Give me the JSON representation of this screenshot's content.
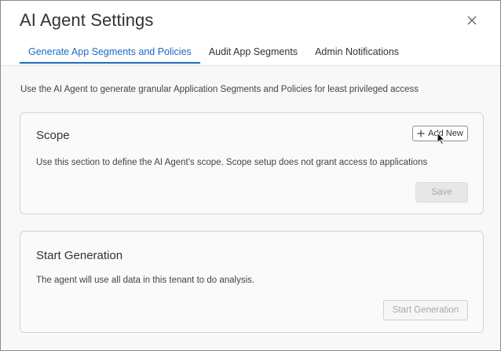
{
  "dialog": {
    "title": "AI Agent Settings",
    "close_icon": "close-icon"
  },
  "tabs": [
    {
      "label": "Generate App Segments and Policies",
      "active": true
    },
    {
      "label": "Audit App Segments",
      "active": false
    },
    {
      "label": "Admin Notifications",
      "active": false
    }
  ],
  "intro": "Use the AI Agent to generate granular Application Segments and Policies for least privileged access",
  "scope": {
    "title": "Scope",
    "add_new_label": "Add New",
    "add_icon": "plus-icon",
    "description": "Use this section to define the AI Agent's scope. Scope setup does not grant access to applications",
    "save_label": "Save"
  },
  "generation": {
    "title": "Start Generation",
    "description": "The agent will use all data in this tenant to do analysis.",
    "start_label": "Start Generation"
  },
  "colors": {
    "accent": "#1e6ac2",
    "background": "#f8f8f8",
    "card_border": "#d4d4d4"
  }
}
